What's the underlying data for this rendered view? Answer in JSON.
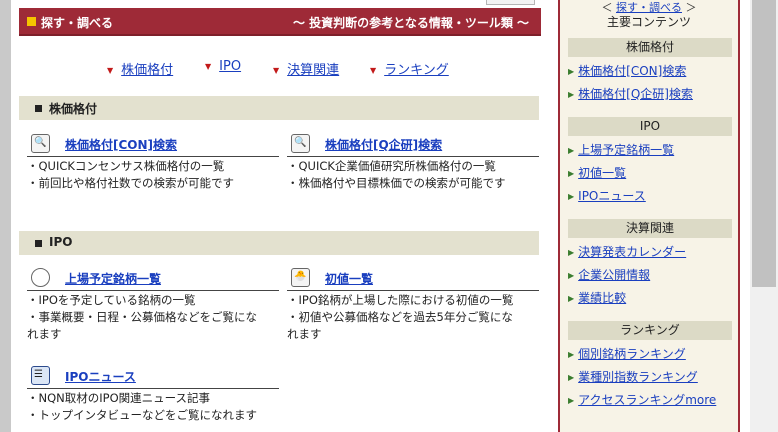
{
  "header": {
    "title": "探す・調べる",
    "subtitle": "～ 投資判断の参考となる情報・ツール類 ～"
  },
  "quicknav": [
    {
      "label": "株価格付"
    },
    {
      "label": "IPO"
    },
    {
      "label": "決算関連"
    },
    {
      "label": "ランキング"
    }
  ],
  "sections": [
    {
      "label": "株価格付",
      "items": [
        {
          "title": "株価格付[CON]検索",
          "icon": "magnifier-chart-icon",
          "desc": [
            "・QUICKコンセンサス株価格付の一覧",
            "・前回比や格付社数での検索が可能です"
          ]
        },
        {
          "title": "株価格付[Q企研]検索",
          "icon": "magnifier-report-icon",
          "desc": [
            "・QUICK企業価値研究所株価格付の一覧",
            "・株価格付や目標株価での検索が可能です"
          ]
        }
      ]
    },
    {
      "label": "IPO",
      "items": [
        {
          "title": "上場予定銘柄一覧",
          "icon": "egg-icon",
          "desc": [
            "・IPOを予定している銘柄の一覧",
            "・事業概要・日程・公募価格などをご覧にな",
            "れます"
          ]
        },
        {
          "title": "初値一覧",
          "icon": "hatching-chick-icon",
          "desc": [
            "・IPO銘柄が上場した際における初値の一覧",
            "・初値や公募価格などを過去5年分ご覧にな",
            "れます"
          ]
        },
        {
          "title": "IPOニュース",
          "icon": "news-document-icon",
          "desc": [
            "・NQN取材のIPO関連ニュース記事",
            "・トップインタビューなどをご覧になれます"
          ]
        }
      ]
    }
  ],
  "sidebar": {
    "breadcrumb_link": "探す・調べる",
    "title": "主要コンテンツ",
    "categories": [
      {
        "label": "株価格付",
        "links": [
          "株価格付[CON]検索",
          "株価格付[Q企研]検索"
        ]
      },
      {
        "label": "IPO",
        "links": [
          "上場予定銘柄一覧",
          "初値一覧",
          "IPOニュース"
        ]
      },
      {
        "label": "決算関連",
        "links": [
          "決算発表カレンダー",
          "企業公開情報",
          "業績比較"
        ]
      },
      {
        "label": "ランキング",
        "links": [
          "個別銘柄ランキング",
          "業種別指数ランキング",
          "アクセスランキングmore"
        ]
      }
    ]
  },
  "colors": {
    "header_bg": "#9e2a37",
    "accent_square": "#f5c400",
    "link": "#1a3fbf",
    "section_bg": "#e3e1cf"
  }
}
